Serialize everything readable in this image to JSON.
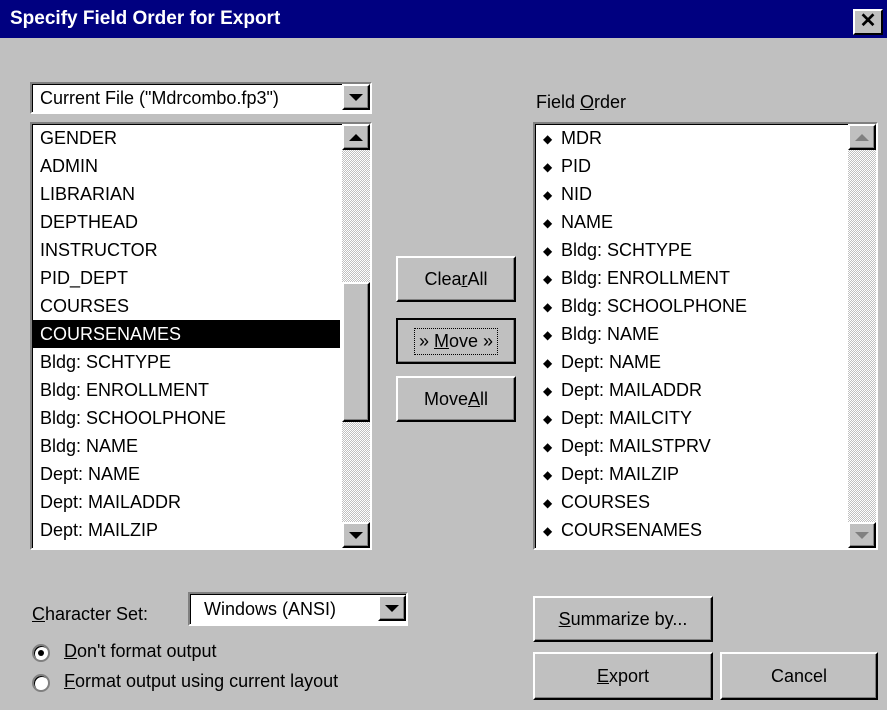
{
  "dialog": {
    "title": "Specify Field Order for Export",
    "close_label": "✕"
  },
  "source": {
    "selected": "Current File (\"Mdrcombo.fp3\")"
  },
  "source_fields": [
    "GENDER",
    "ADMIN",
    "LIBRARIAN",
    "DEPTHEAD",
    "INSTRUCTOR",
    "PID_DEPT",
    "COURSES",
    "COURSENAMES",
    "Bldg: SCHTYPE",
    "Bldg: ENROLLMENT",
    "Bldg: SCHOOLPHONE",
    "Bldg: NAME",
    "Dept: NAME",
    "Dept: MAILADDR",
    "Dept: MAILZIP"
  ],
  "selected_source_field": "COURSENAMES",
  "field_order": {
    "label_pre": "Field ",
    "label_key": "O",
    "label_post": "rder",
    "items": [
      "MDR",
      "PID",
      "NID",
      "NAME",
      "Bldg: SCHTYPE",
      "Bldg: ENROLLMENT",
      "Bldg: SCHOOLPHONE",
      "Bldg: NAME",
      "Dept: NAME",
      "Dept: MAILADDR",
      "Dept: MAILCITY",
      "Dept: MAILSTPRV",
      "Dept: MAILZIP",
      "COURSES",
      "COURSENAMES"
    ]
  },
  "buttons": {
    "clear_pre": "Clea",
    "clear_key": "r",
    "clear_post": " All",
    "move_pre": "» ",
    "move_key": "M",
    "move_post": "ove »",
    "moveall_pre": "Move ",
    "moveall_key": "A",
    "moveall_post": "ll",
    "summarize_key": "S",
    "summarize_post": "ummarize by...",
    "export_key": "E",
    "export_post": "xport",
    "cancel": "Cancel"
  },
  "charset": {
    "label_key": "C",
    "label_post": "haracter Set:",
    "selected": "Windows (ANSI)"
  },
  "options": [
    {
      "key": "D",
      "post": "on't format output",
      "checked": true
    },
    {
      "key": "F",
      "post": "ormat output using current layout",
      "checked": false
    }
  ]
}
